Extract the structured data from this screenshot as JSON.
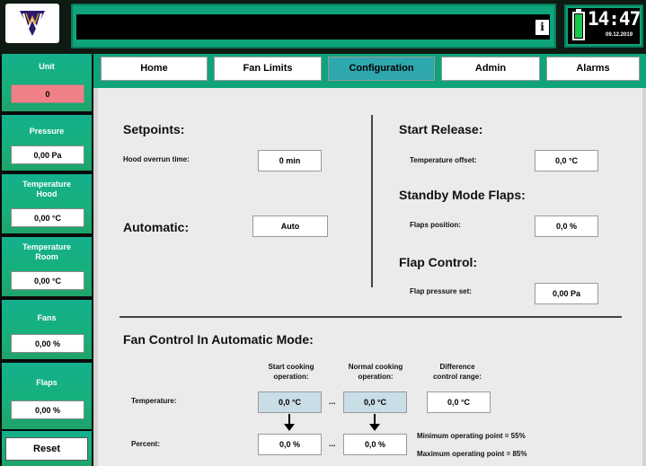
{
  "header": {
    "logo_icon": "w-crest-logo",
    "info_label": "i",
    "clock_time": "14:47",
    "clock_date": "09.12.2019"
  },
  "sidebar": {
    "unit": {
      "label": "Unit",
      "value": "0"
    },
    "pressure": {
      "label": "Pressure",
      "value": "0,00 Pa"
    },
    "temp_hood": {
      "label_line1": "Temperature",
      "label_line2": "Hood",
      "value": "0,00 °C"
    },
    "temp_room": {
      "label_line1": "Temperature",
      "label_line2": "Room",
      "value": "0,00 °C"
    },
    "fans": {
      "label": "Fans",
      "value": "0,00 %"
    },
    "flaps": {
      "label": "Flaps",
      "value": "0,00 %"
    },
    "reset_label": "Reset"
  },
  "tabs": [
    {
      "label": "Home"
    },
    {
      "label": "Fan Limits"
    },
    {
      "label": "Configuration"
    },
    {
      "label": "Admin"
    },
    {
      "label": "Alarms"
    }
  ],
  "setpoints": {
    "title": "Setpoints:",
    "hood_overrun_label": "Hood overrun time:",
    "hood_overrun_value": "0 min"
  },
  "automatic": {
    "title": "Automatic:",
    "button_label": "Auto"
  },
  "start_release": {
    "title": "Start Release:",
    "temp_offset_label": "Temperature offset:",
    "temp_offset_value": "0,0 °C"
  },
  "standby": {
    "title": "Standby Mode Flaps:",
    "flaps_position_label": "Flaps position:",
    "flaps_position_value": "0,0 %"
  },
  "flap_control": {
    "title": "Flap Control:",
    "pressure_set_label": "Flap pressure set:",
    "pressure_set_value": "0,00 Pa"
  },
  "fan_control": {
    "title": "Fan Control In Automatic Mode:",
    "col_start_1": "Start cooking",
    "col_start_2": "operation:",
    "col_normal_1": "Normal cooking",
    "col_normal_2": "operation:",
    "col_diff_1": "Difference",
    "col_diff_2": "control range:",
    "temp_label": "Temperature:",
    "temp_start": "0,0 °C",
    "temp_normal": "0,0 °C",
    "temp_diff": "0,0 °C",
    "range_sep": "...",
    "percent_label": "Percent:",
    "pct_start": "0,0 %",
    "pct_normal": "0,0 %",
    "min_point": "Minimum operating point = 55%",
    "max_point": "Maximum operating point = 85%"
  }
}
